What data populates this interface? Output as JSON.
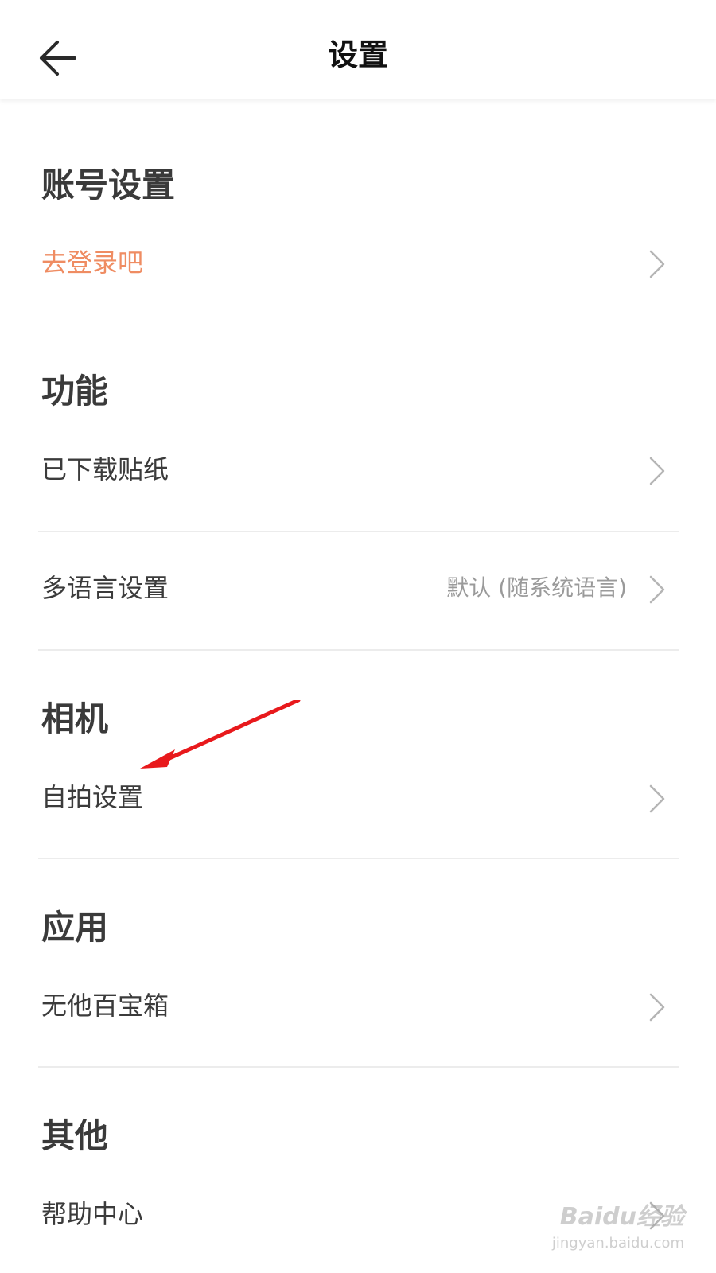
{
  "header": {
    "title": "设置",
    "back_icon": "arrow-left-icon"
  },
  "sections": {
    "account": {
      "title": "账号设置",
      "items": [
        {
          "label": "去登录吧",
          "accent": "#ef8c62"
        }
      ]
    },
    "features": {
      "title": "功能",
      "items": [
        {
          "label": "已下载贴纸"
        },
        {
          "label": "多语言设置",
          "value": "默认 (随系统语言)"
        }
      ]
    },
    "camera": {
      "title": "相机",
      "items": [
        {
          "label": "自拍设置"
        }
      ]
    },
    "apps": {
      "title": "应用",
      "items": [
        {
          "label": "无他百宝箱"
        }
      ]
    },
    "others": {
      "title": "其他",
      "items": [
        {
          "label": "帮助中心"
        }
      ]
    }
  },
  "annotation": {
    "arrow_color": "#e8191c"
  },
  "watermark": {
    "brand": "Baidu经验",
    "url": "jingyan.baidu.com"
  },
  "colors": {
    "text": "#3b3b3b",
    "accent": "#ef8c62",
    "secondary": "#9a9a9a",
    "divider": "#ececec"
  }
}
